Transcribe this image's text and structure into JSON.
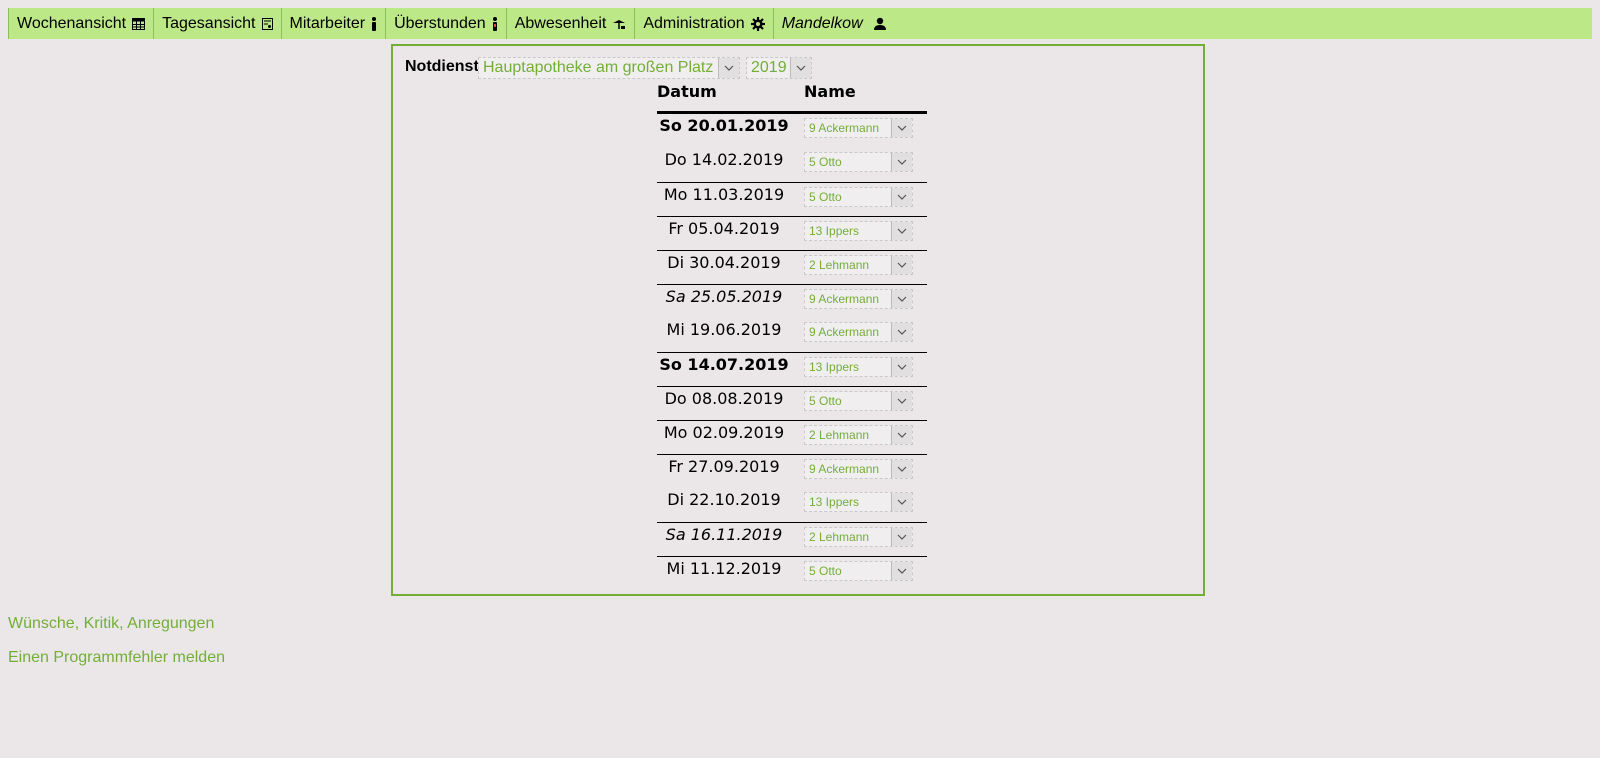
{
  "nav": {
    "items": [
      {
        "label": "Wochenansicht",
        "icon": "calendar-grid-icon"
      },
      {
        "label": "Tagesansicht",
        "icon": "calendar-day-icon"
      },
      {
        "label": "Mitarbeiter",
        "icon": "person-icon"
      },
      {
        "label": "Überstunden",
        "icon": "person-clock-icon"
      },
      {
        "label": "Abwesenheit",
        "icon": "vacation-icon"
      },
      {
        "label": "Administration",
        "icon": "gear-icon"
      },
      {
        "label": "Mandelkow",
        "icon": "user-icon"
      }
    ]
  },
  "notdienst": {
    "label": "Notdienst",
    "apotheke": "Hauptapotheke am großen Platz",
    "year": "2019"
  },
  "table": {
    "headers": {
      "datum": "Datum",
      "name": "Name"
    },
    "rows": [
      {
        "date": "So 20.01.2019",
        "name": "9 Ackermann",
        "style": "bold"
      },
      {
        "date": "Do 14.02.2019",
        "name": "5 Otto",
        "style": "normal"
      },
      {
        "date": "Mo 11.03.2019",
        "name": "5 Otto",
        "style": "normal"
      },
      {
        "date": "Fr 05.04.2019",
        "name": "13 Ippers",
        "style": "normal"
      },
      {
        "date": "Di 30.04.2019",
        "name": "2 Lehmann",
        "style": "normal"
      },
      {
        "date": "Sa 25.05.2019",
        "name": "9 Ackermann",
        "style": "italic"
      },
      {
        "date": "Mi 19.06.2019",
        "name": "9 Ackermann",
        "style": "normal"
      },
      {
        "date": "So 14.07.2019",
        "name": "13 Ippers",
        "style": "bold"
      },
      {
        "date": "Do 08.08.2019",
        "name": "5 Otto",
        "style": "normal"
      },
      {
        "date": "Mo 02.09.2019",
        "name": "2 Lehmann",
        "style": "normal"
      },
      {
        "date": "Fr 27.09.2019",
        "name": "9 Ackermann",
        "style": "normal"
      },
      {
        "date": "Di 22.10.2019",
        "name": "13 Ippers",
        "style": "normal"
      },
      {
        "date": "Sa 16.11.2019",
        "name": "2 Lehmann",
        "style": "italic"
      },
      {
        "date": "Mi 11.12.2019",
        "name": "5 Otto",
        "style": "normal"
      }
    ]
  },
  "footer": {
    "feedback": "Wünsche, Kritik, Anregungen",
    "bugreport": "Einen Programmfehler melden"
  },
  "colors": {
    "navbar": "#bde887",
    "accent": "#73ae38",
    "background": "#ebe7e9"
  }
}
